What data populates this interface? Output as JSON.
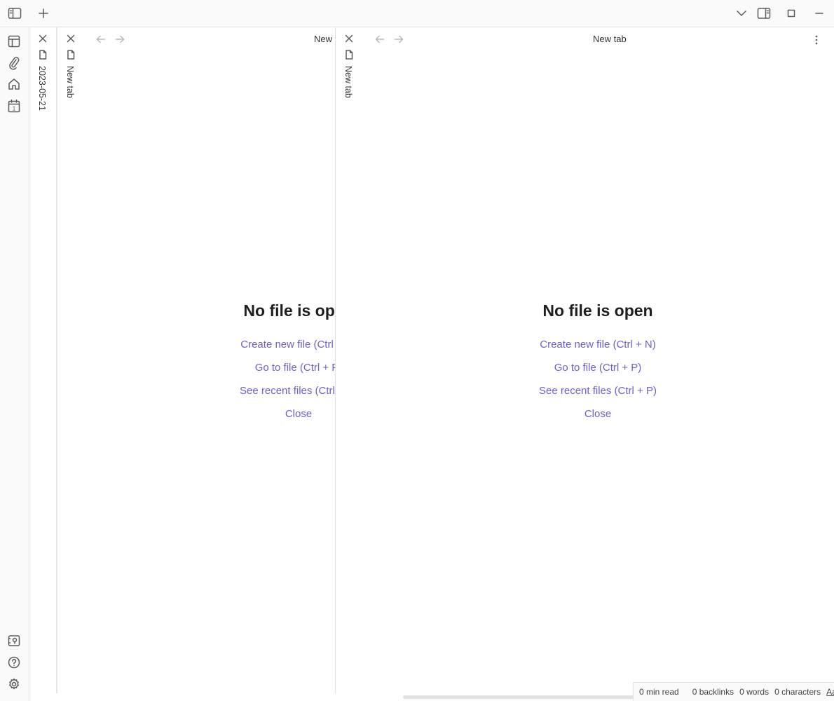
{
  "left_strip": {
    "tab_label": "2023-05-21"
  },
  "middle_strip": {
    "tab_label": "New tab"
  },
  "pane1": {
    "title": "New tab",
    "empty_title": "No file is open",
    "links": [
      "Create new file (Ctrl + N)",
      "Go to file (Ctrl + P)",
      "See recent files (Ctrl + P)",
      "Close"
    ]
  },
  "right_strip": {
    "tab_label": "New tab"
  },
  "pane2": {
    "title": "New tab",
    "empty_title": "No file is open",
    "links": [
      "Create new file (Ctrl + N)",
      "Go to file (Ctrl + P)",
      "See recent files (Ctrl + P)",
      "Close"
    ]
  },
  "status_bar": {
    "read_time": "0 min read",
    "backlinks": "0 backlinks",
    "words": "0 words",
    "characters": "0 characters",
    "aa": "Aa"
  },
  "icons": {
    "titlebar": [
      "sidebar-toggle-icon",
      "new-tab-plus-icon",
      "chevron-down-icon",
      "right-sidebar-icon",
      "maximize-icon",
      "minimize-icon"
    ],
    "ribbon": [
      "layout-icon",
      "paperclip-icon",
      "home-icon",
      "calendar-icon",
      "vault-icon",
      "help-icon",
      "settings-icon"
    ]
  }
}
